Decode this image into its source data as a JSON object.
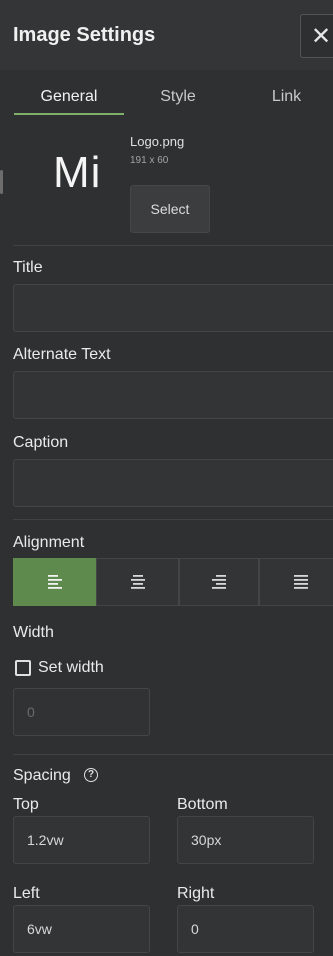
{
  "header": {
    "title": "Image Settings",
    "close_symbol": "✕"
  },
  "tabs": [
    {
      "label": "General",
      "active": true
    },
    {
      "label": "Style",
      "active": false
    },
    {
      "label": "Link",
      "active": false
    }
  ],
  "image": {
    "preview_text": "Mi",
    "file_name": "Logo.png",
    "dimensions": "191 x 60",
    "select_label": "Select"
  },
  "fields": {
    "title_label": "Title",
    "title_value": "",
    "alt_label": "Alternate Text",
    "alt_value": "",
    "caption_label": "Caption",
    "caption_value": ""
  },
  "alignment": {
    "label": "Alignment",
    "options": [
      "align-left-icon",
      "align-center-icon",
      "align-right-icon",
      "align-justify-icon"
    ],
    "selected": 0
  },
  "width": {
    "label": "Width",
    "checkbox_label": "Set width",
    "checked": false,
    "value": "0"
  },
  "spacing": {
    "label": "Spacing",
    "top_label": "Top",
    "top_value": "1.2vw",
    "bottom_label": "Bottom",
    "bottom_value": "30px",
    "left_label": "Left",
    "left_value": "6vw",
    "right_label": "Right",
    "right_value": "0"
  },
  "colors": {
    "accent": "#5e8a4d",
    "tab_underline": "#7fb06a",
    "background": "#2f3031"
  }
}
